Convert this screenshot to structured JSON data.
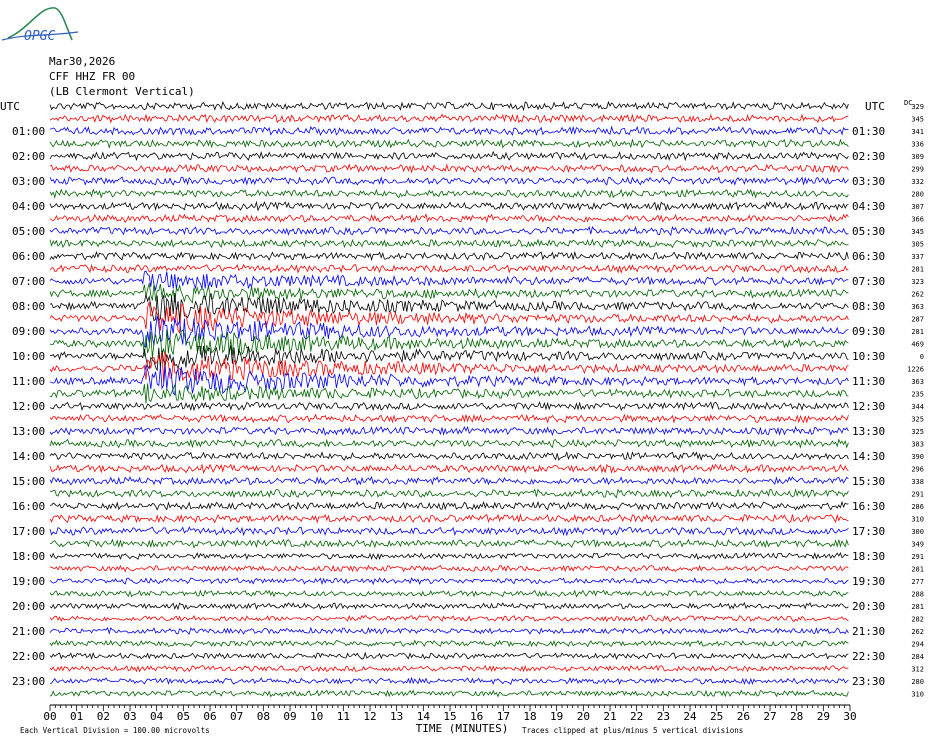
{
  "header": {
    "logo_text": "OPGC",
    "date": "Mar30,2026",
    "station": "CFF HHZ FR 00",
    "site": "(LB Clermont Vertical)"
  },
  "chart_data": {
    "type": "line",
    "title": "",
    "left_axis_label": "UTC",
    "right_axis_label": "UTC",
    "right_column_header": "DC",
    "xlabel": "TIME (MINUTES)",
    "x_ticks": [
      "00",
      "01",
      "02",
      "03",
      "04",
      "05",
      "06",
      "07",
      "08",
      "09",
      "10",
      "11",
      "12",
      "13",
      "14",
      "15",
      "16",
      "17",
      "18",
      "19",
      "20",
      "21",
      "22",
      "23",
      "24",
      "25",
      "26",
      "27",
      "28",
      "29",
      "30"
    ],
    "xlim": [
      0,
      30
    ],
    "left_labels": [
      "UTC",
      "01:00",
      "02:00",
      "03:00",
      "04:00",
      "05:00",
      "06:00",
      "07:00",
      "08:00",
      "09:00",
      "10:00",
      "11:00",
      "12:00",
      "13:00",
      "14:00",
      "15:00",
      "16:00",
      "17:00",
      "18:00",
      "19:00",
      "20:00",
      "21:00",
      "22:00",
      "23:00"
    ],
    "right_labels": [
      "UTC",
      "01:30",
      "02:30",
      "03:30",
      "04:30",
      "05:30",
      "06:30",
      "07:30",
      "08:30",
      "09:30",
      "10:30",
      "11:30",
      "12:30",
      "13:30",
      "14:30",
      "15:30",
      "16:30",
      "17:30",
      "18:30",
      "19:30",
      "20:30",
      "21:30",
      "22:30",
      "23:30"
    ],
    "dc_offsets": [
      329,
      345,
      341,
      336,
      309,
      299,
      332,
      280,
      307,
      366,
      345,
      305,
      337,
      281,
      323,
      262,
      363,
      287,
      281,
      469,
      0,
      1226,
      363,
      235,
      344,
      325,
      325,
      383,
      390,
      296,
      338,
      291,
      286,
      310,
      300,
      349,
      291,
      281,
      277,
      288,
      281,
      282,
      262,
      294,
      284,
      312,
      280,
      310
    ],
    "trace_colors": [
      "#000000",
      "#ff0000",
      "#0000ff",
      "#006400"
    ],
    "footer": {
      "vertical_division": "Each Vertical Division =  100.00 microvolts",
      "clip_note": "Traces clipped at plus/minus 5 vertical divisions"
    }
  }
}
